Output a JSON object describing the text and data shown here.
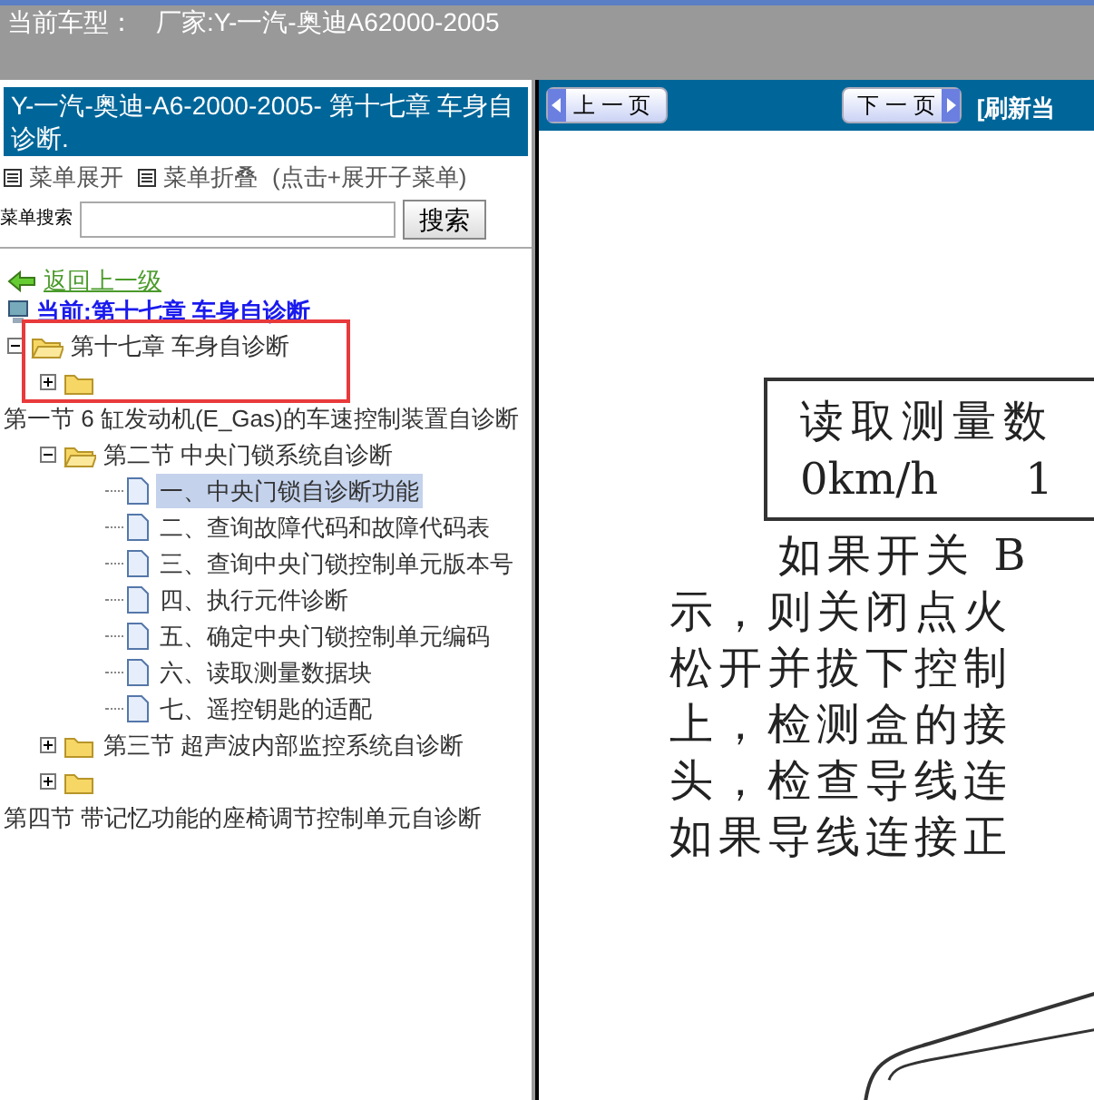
{
  "header": {
    "label": "当前车型：",
    "value": "厂家:Y-一汽-奥迪A62000-2005"
  },
  "sidebar": {
    "title": "Y-一汽-奥迪-A6-2000-2005- 第十七章 车身自诊断.",
    "menu_links": [
      "菜单展开",
      "菜单折叠"
    ],
    "menu_hint": "(点击+展开子菜单)",
    "search": {
      "label": "菜单搜索",
      "button": "搜索"
    },
    "back_link": "返回上一级",
    "current": "当前:第十七章 车身自诊断",
    "tree": [
      {
        "kind": "folder",
        "label": "第十七章 车身自诊断",
        "expanded": true,
        "annotated": true,
        "children": [
          {
            "kind": "folder",
            "expanded": false
          },
          {
            "kind": "text",
            "label": "第一节 6 缸发动机(E_Gas)的车速控制装置自诊断"
          },
          {
            "kind": "folder",
            "label": "第二节 中央门锁系统自诊断",
            "expanded": true,
            "children": [
              {
                "kind": "page",
                "label": "一、中央门锁自诊断功能",
                "selected": true
              },
              {
                "kind": "page",
                "label": "二、查询故障代码和故障代码表",
                "selected": false
              },
              {
                "kind": "page",
                "label": "三、查询中央门锁控制单元版本号",
                "selected": false
              },
              {
                "kind": "page",
                "label": "四、执行元件诊断",
                "selected": false
              },
              {
                "kind": "page",
                "label": "五、确定中央门锁控制单元编码",
                "selected": false
              },
              {
                "kind": "page",
                "label": "六、读取测量数据块",
                "selected": false
              },
              {
                "kind": "page",
                "label": "七、遥控钥匙的适配",
                "selected": false
              }
            ]
          },
          {
            "kind": "folder",
            "label": "第三节 超声波内部监控系统自诊断",
            "expanded": false
          },
          {
            "kind": "folder",
            "expanded": false
          },
          {
            "kind": "text",
            "label": "第四节 带记忆功能的座椅调节控制单元自诊断"
          }
        ]
      }
    ]
  },
  "viewer": {
    "prev_button": "上 一 页",
    "next_button": "下 一 页",
    "refresh_link": "[刷新当",
    "document": {
      "box_lines": [
        "读取测量数",
        "0km/h",
        "1"
      ],
      "paragraph": [
        "如果开关 B",
        "示，则关闭点火",
        "松开并拔下控制",
        "上，检测盒的接",
        "头，检查导线连",
        "如果导线连接正"
      ]
    }
  }
}
